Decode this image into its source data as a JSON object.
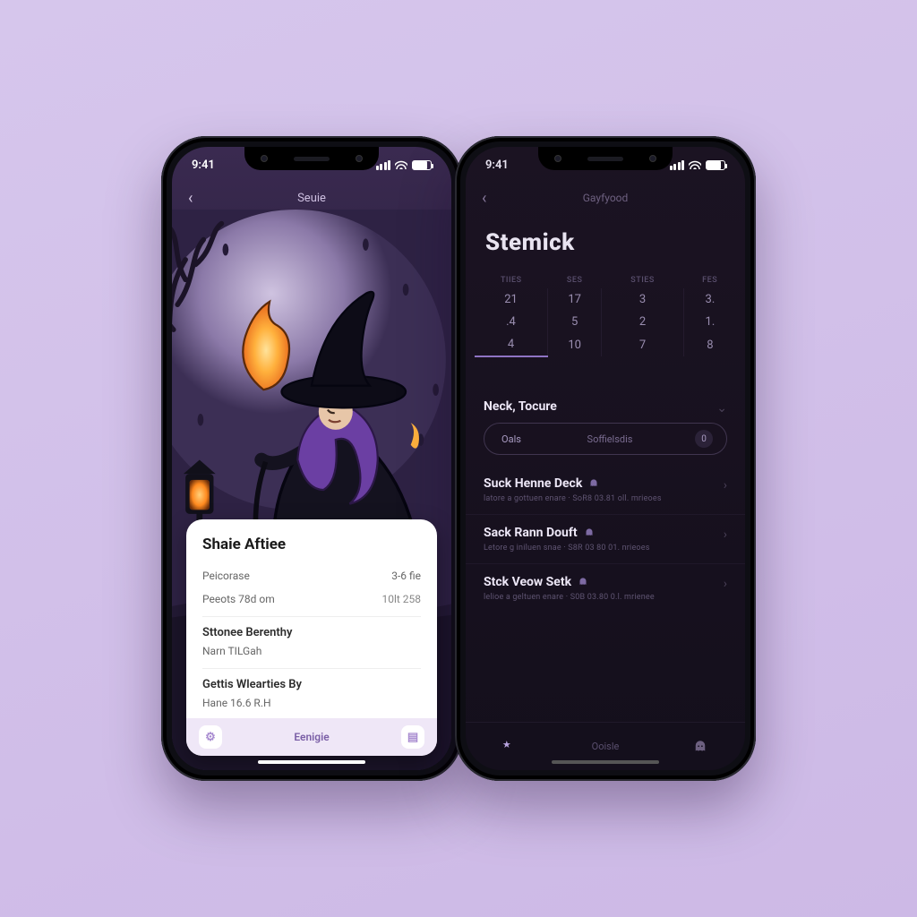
{
  "status": {
    "time": "9:41"
  },
  "screenA": {
    "nav_title": "Seuie",
    "card": {
      "title": "Shaie Aftiee",
      "row1": {
        "label": "Peicorase",
        "value": "3-6 fie"
      },
      "row2": {
        "label": "Peeots 78d om",
        "value": "10lt 258"
      },
      "sub1": "Sttonee Berenthy",
      "sub1_meta": "Narn TILGah",
      "sub2": "Gettis Wlearties By",
      "sub2_meta": "Hane 16.6 R.H",
      "footer_label": "Eenigie"
    }
  },
  "screenB": {
    "nav_title": "Gayfyood",
    "title": "Stemick",
    "calendar": {
      "headers": [
        "TIIES",
        "SES",
        "STIES",
        "FES"
      ],
      "rows": [
        [
          "21",
          "17",
          "3",
          "3."
        ],
        [
          ".4",
          "5",
          "2",
          "1."
        ],
        [
          "4",
          "10",
          "7",
          "8"
        ]
      ],
      "selected_col": 0
    },
    "section1": {
      "title": "Neck, Tocure",
      "segment": {
        "left": "Oals",
        "mid": "Soffielsdis",
        "right_badge": "0"
      }
    },
    "items": [
      {
        "title": "Suck Henne Deck",
        "subtitle": "latore a gottuen enare · SoR8 03.81 oll. mrieoes"
      },
      {
        "title": "Sack Rann Douft",
        "subtitle": "Letore g iniluen snae · S8R 03 80 01. nrieoes"
      },
      {
        "title": "Stck Veow Setk",
        "subtitle": "lelioe a geltuen enare · S0B 03.80 0.l. mrienee"
      }
    ],
    "tabs": {
      "left": "",
      "mid": "Ooisle",
      "right": ""
    }
  }
}
